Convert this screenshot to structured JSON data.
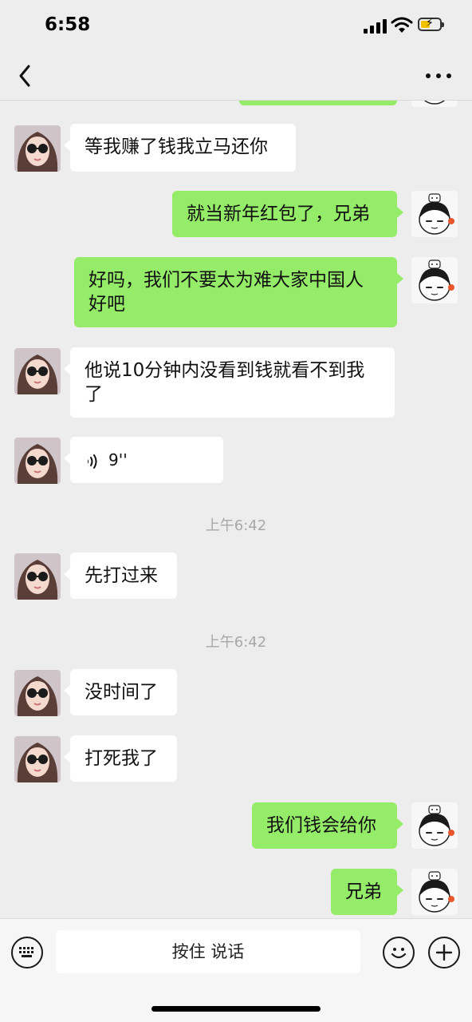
{
  "status": {
    "time": "6:58"
  },
  "nav": {
    "title": ""
  },
  "messages": [
    {
      "side": "in",
      "kind": "text",
      "text": "等我赚了钱我立马还你"
    },
    {
      "side": "out",
      "kind": "text",
      "text": "就当新年红包了，兄弟"
    },
    {
      "side": "out",
      "kind": "text",
      "text": "好吗，我们不要太为难大家中国人\n好吧"
    },
    {
      "side": "in",
      "kind": "text",
      "text": "他说10分钟内没看到钱就看不到我\n了"
    },
    {
      "side": "in",
      "kind": "voice",
      "duration": "9''"
    },
    {
      "kind": "time",
      "text": "上午6:42"
    },
    {
      "side": "in",
      "kind": "text",
      "text": "先打过来"
    },
    {
      "kind": "time",
      "text": "上午6:42"
    },
    {
      "side": "in",
      "kind": "text",
      "text": "没时间了"
    },
    {
      "side": "in",
      "kind": "text",
      "text": "打死我了"
    },
    {
      "side": "out",
      "kind": "text",
      "text": "我们钱会给你"
    },
    {
      "side": "out",
      "kind": "text",
      "text": "兄弟"
    }
  ],
  "input": {
    "hold_to_talk_label": "按住 说话"
  },
  "colors": {
    "background": "#ededed",
    "outgoing_bubble": "#95ec69",
    "incoming_bubble": "#ffffff",
    "timestamp": "#a8a8a8"
  },
  "icons": {
    "back": "chevron-left-icon",
    "more": "more-dots-icon",
    "keyboard": "keyboard-icon",
    "emoji": "emoji-icon",
    "add": "plus-icon",
    "voice": "voice-waves-icon"
  }
}
